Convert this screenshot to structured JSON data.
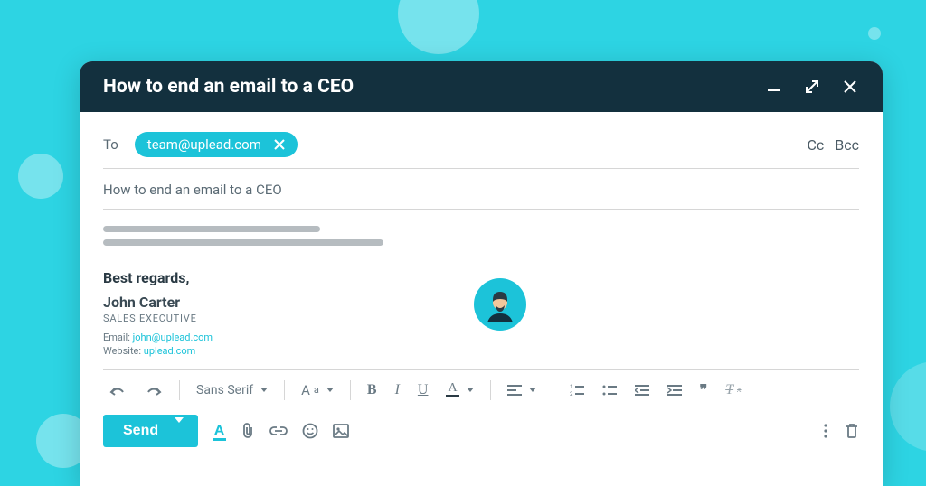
{
  "window": {
    "title": "How to end an email to a CEO"
  },
  "compose": {
    "to_label": "To",
    "recipient": "team@uplead.com",
    "cc_label": "Cc",
    "bcc_label": "Bcc",
    "subject": "How to end an email to a CEO"
  },
  "signature": {
    "closing": "Best regards,",
    "name": "John Carter",
    "title": "SALES EXECUTIVE",
    "email_label": "Email:",
    "email": "john@uplead.com",
    "website_label": "Website:",
    "website": "uplead.com"
  },
  "toolbar": {
    "font_family": "Sans Serif",
    "font_size_label": "Aa",
    "bold": "B",
    "italic": "I",
    "underline": "U",
    "color_label": "A",
    "quote": "❞"
  },
  "actions": {
    "send": "Send",
    "text_color_label": "A"
  }
}
